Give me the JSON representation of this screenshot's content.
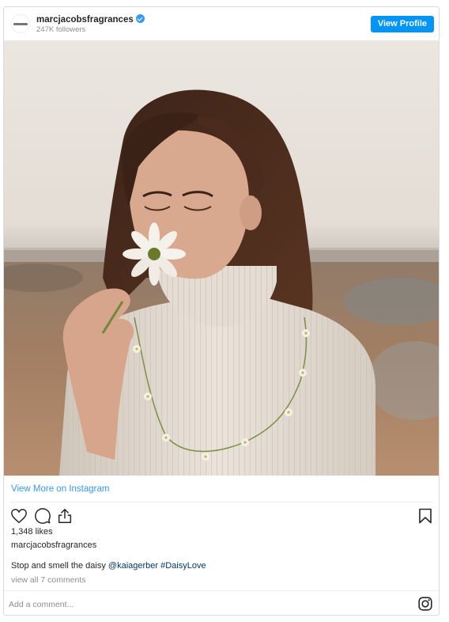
{
  "header": {
    "username": "marcjacobsfragrances",
    "verified": true,
    "followers": "247K followers",
    "view_profile_label": "View Profile"
  },
  "links": {
    "view_more": "View More on Instagram"
  },
  "post": {
    "likes": "1,348 likes",
    "poster": "marcjacobsfragrances",
    "caption_text": "Stop and smell the daisy ",
    "caption_mention": "@kaiagerber",
    "caption_hashtag": "#DaisyLove",
    "view_comments": "view all 7 comments"
  },
  "comment_box": {
    "placeholder": "Add a comment..."
  },
  "icons": {
    "like": "heart-icon",
    "comment": "comment-icon",
    "share": "share-icon",
    "save": "bookmark-icon",
    "instagram": "instagram-icon"
  },
  "colors": {
    "accent": "#0095f6",
    "link": "#3897f0",
    "muted": "#8e8e8e",
    "text": "#262626"
  }
}
